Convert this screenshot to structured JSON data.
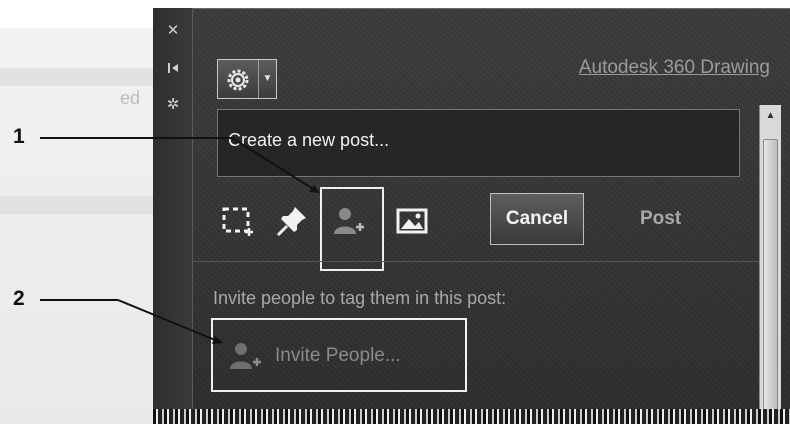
{
  "background_window": {
    "text": "ed"
  },
  "side_bar": {
    "icons": [
      "close-icon",
      "auto-hide-icon",
      "properties-icon"
    ]
  },
  "header": {
    "app_link": "Autodesk 360 Drawing",
    "gear_icon": "gear-icon",
    "dropdown_icon": "caret-down-icon"
  },
  "post": {
    "placeholder": "Create a new post..."
  },
  "tools": {
    "icons": [
      "select-area-icon",
      "pin-icon",
      "add-person-icon",
      "image-icon"
    ]
  },
  "actions": {
    "cancel_label": "Cancel",
    "post_label": "Post"
  },
  "invite": {
    "label": "Invite people to tag them in this post:",
    "button_label": "Invite People..."
  },
  "callouts": {
    "one": "1",
    "two": "2"
  },
  "colors": {
    "panel": "#333333",
    "highlight": "#f0f0f0",
    "text_muted": "#a8a8a8"
  }
}
